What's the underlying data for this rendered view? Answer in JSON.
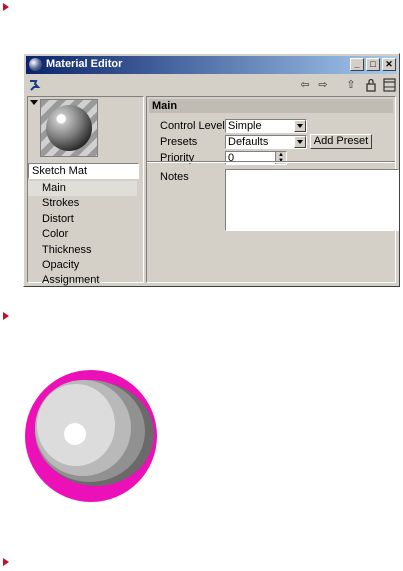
{
  "window": {
    "title": "Material Editor",
    "title_buttons": {
      "minimize": "_",
      "maximize": "□",
      "close": "✕"
    }
  },
  "toolbar": {
    "pin_icon": "pushpin-icon",
    "back_icon": "arrow-left-icon",
    "forward_icon": "arrow-right-icon",
    "up_icon": "arrow-up-icon",
    "lock_icon": "lock-icon",
    "panel_icon": "panel-icon"
  },
  "left_panel": {
    "material_name": "Sketch Mat",
    "tree": [
      "Main",
      "Strokes",
      "Distort",
      "Color",
      "Thickness",
      "Opacity",
      "Assignment"
    ],
    "selected": "Main"
  },
  "main": {
    "section_title": "Main",
    "control_level": {
      "label": "Control Level",
      "value": "Simple"
    },
    "presets": {
      "label": "Presets",
      "value": "Defaults",
      "button": "Add Preset"
    },
    "priority": {
      "label": "Priority",
      "value": "0"
    },
    "notes": {
      "label": "Notes",
      "value": ""
    }
  },
  "figure": {
    "colors": {
      "outline": "#ec10b8",
      "band_dark": "#6a6a6a",
      "band_mid": "#919191",
      "band_light": "#b9b9b9",
      "band_lightest": "#dcdcdc",
      "highlight": "#ffffff"
    }
  },
  "colors": {
    "bullet": "#c0102c",
    "titlebar": "#0a246a",
    "window_bg": "#d4d0c8"
  }
}
